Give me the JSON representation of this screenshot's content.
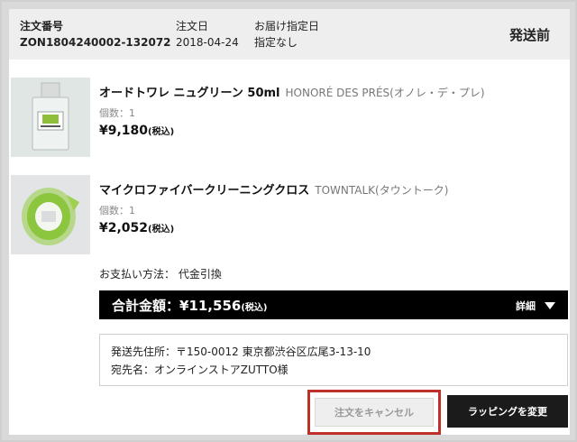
{
  "order": {
    "number_label": "注文番号",
    "number": "ZON1804240002-132072",
    "date_label": "注文日",
    "date": "2018-04-24",
    "delivery_label": "お届け指定日",
    "delivery": "指定なし",
    "status": "発送前"
  },
  "items": [
    {
      "name": "オードトワレ ニュグリーン 50ml",
      "brand": "HONORÉ DES PRÉS(オノレ・デ・プレ)",
      "qty": "個数：1",
      "price": "¥9,180",
      "tax": "(税込)"
    },
    {
      "name": "マイクロファイバークリーニングクロス",
      "brand": "TOWNTALK(タウントーク)",
      "qty": "個数：1",
      "price": "¥2,052",
      "tax": "(税込)"
    }
  ],
  "payment": {
    "label": "お支払い方法：",
    "method": "代金引換"
  },
  "total": {
    "label": "合計金額：¥11,556",
    "tax": "(税込)",
    "detail_label": "詳細"
  },
  "shipping": {
    "address": "発送先住所：〒150-0012 東京都渋谷区広尾3-13-10",
    "recipient": "宛先名：オンラインストアZUTTO様"
  },
  "buttons": {
    "cancel": "注文をキャンセル",
    "wrapping": "ラッピングを変更"
  },
  "colors": {
    "highlight": "#c0302a",
    "total_bar": "#000000",
    "header_bg": "#eeeeee"
  }
}
